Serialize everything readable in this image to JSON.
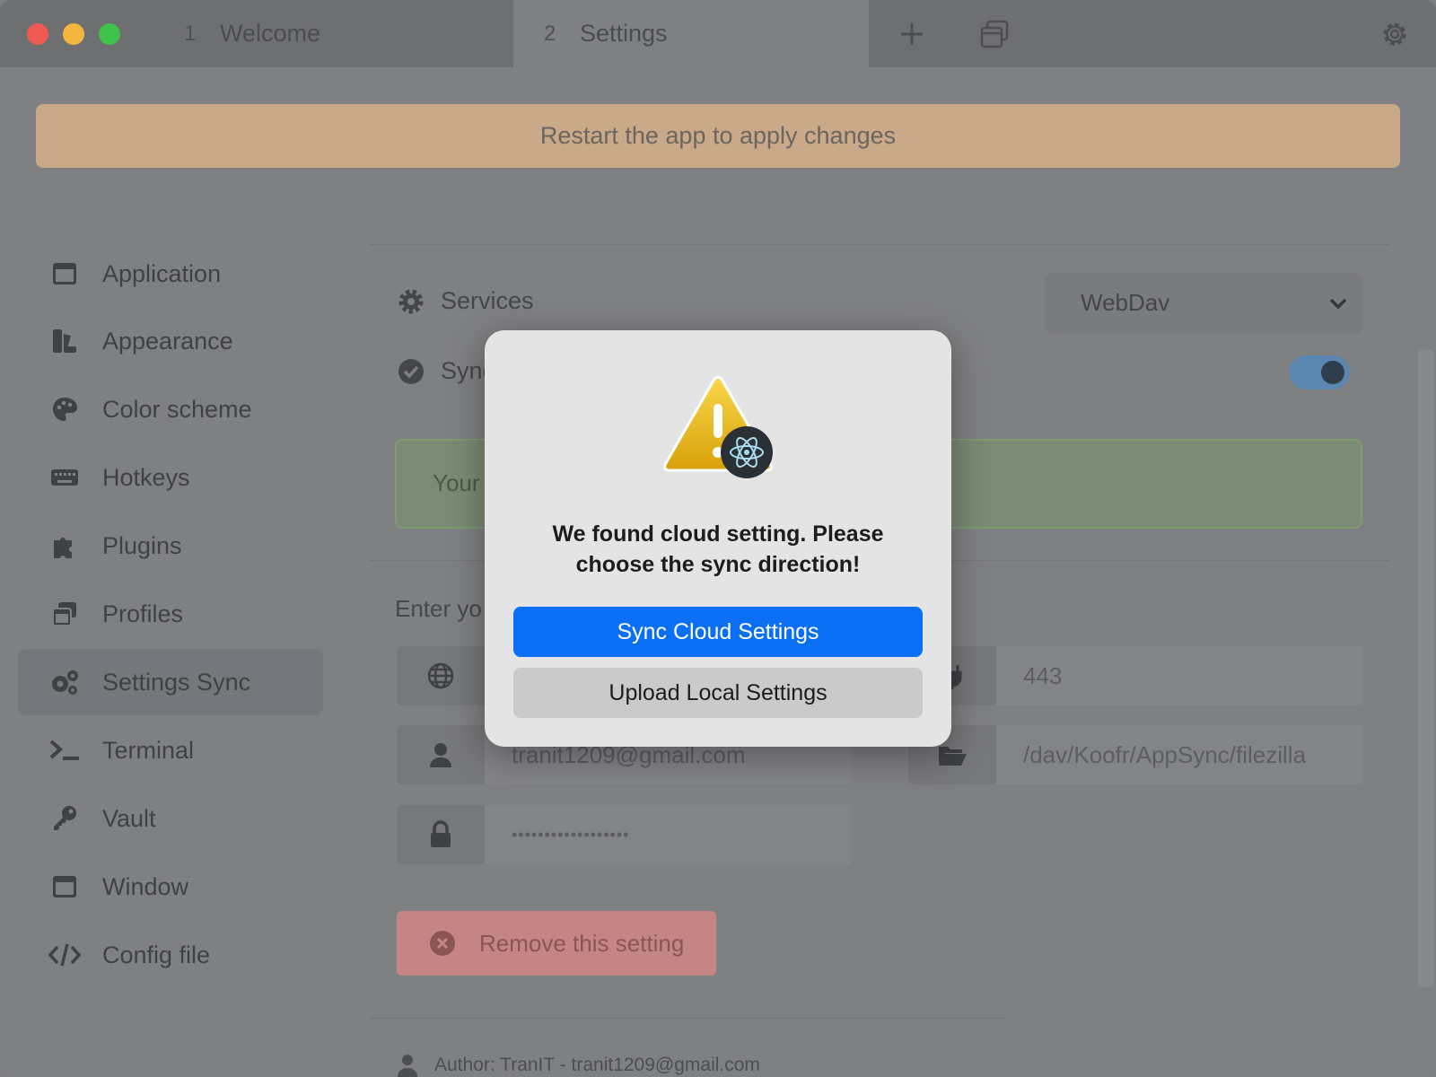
{
  "tabs": [
    {
      "number": "1",
      "label": "Welcome"
    },
    {
      "number": "2",
      "label": "Settings"
    }
  ],
  "banner": {
    "text": "Restart the app to apply changes"
  },
  "sidebar": {
    "items": [
      {
        "label": "Application",
        "icon": "window-icon"
      },
      {
        "label": "Appearance",
        "icon": "swatchbook-icon"
      },
      {
        "label": "Color scheme",
        "icon": "palette-icon"
      },
      {
        "label": "Hotkeys",
        "icon": "keyboard-icon"
      },
      {
        "label": "Plugins",
        "icon": "puzzle-icon"
      },
      {
        "label": "Profiles",
        "icon": "window-stack-icon"
      },
      {
        "label": "Settings Sync",
        "icon": "gears-icon",
        "active": true
      },
      {
        "label": "Terminal",
        "icon": "terminal-icon"
      },
      {
        "label": "Vault",
        "icon": "key-icon"
      },
      {
        "label": "Window",
        "icon": "window-icon"
      },
      {
        "label": "Config file",
        "icon": "code-icon"
      }
    ]
  },
  "main": {
    "services_label": "Services",
    "services_value": "WebDav",
    "sync_label": "Sync",
    "sync_enabled": true,
    "status_text": "Your",
    "enter_label": "Enter yo",
    "port_value": "443",
    "username_value": "tranit1209@gmail.com",
    "path_value": "/dav/Koofr/AppSync/filezilla",
    "password_value": "••••••••••••••••••",
    "remove_label": "Remove this setting",
    "author_text": "Author: TranIT - tranit1209@gmail.com"
  },
  "dialog": {
    "message": "We found cloud setting. Please choose the sync direction!",
    "primary_label": "Sync Cloud Settings",
    "secondary_label": "Upload Local Settings"
  },
  "colors": {
    "primary_button": "#0a6ff2",
    "banner": "#c9a987",
    "toggle": "#5b86b0"
  }
}
